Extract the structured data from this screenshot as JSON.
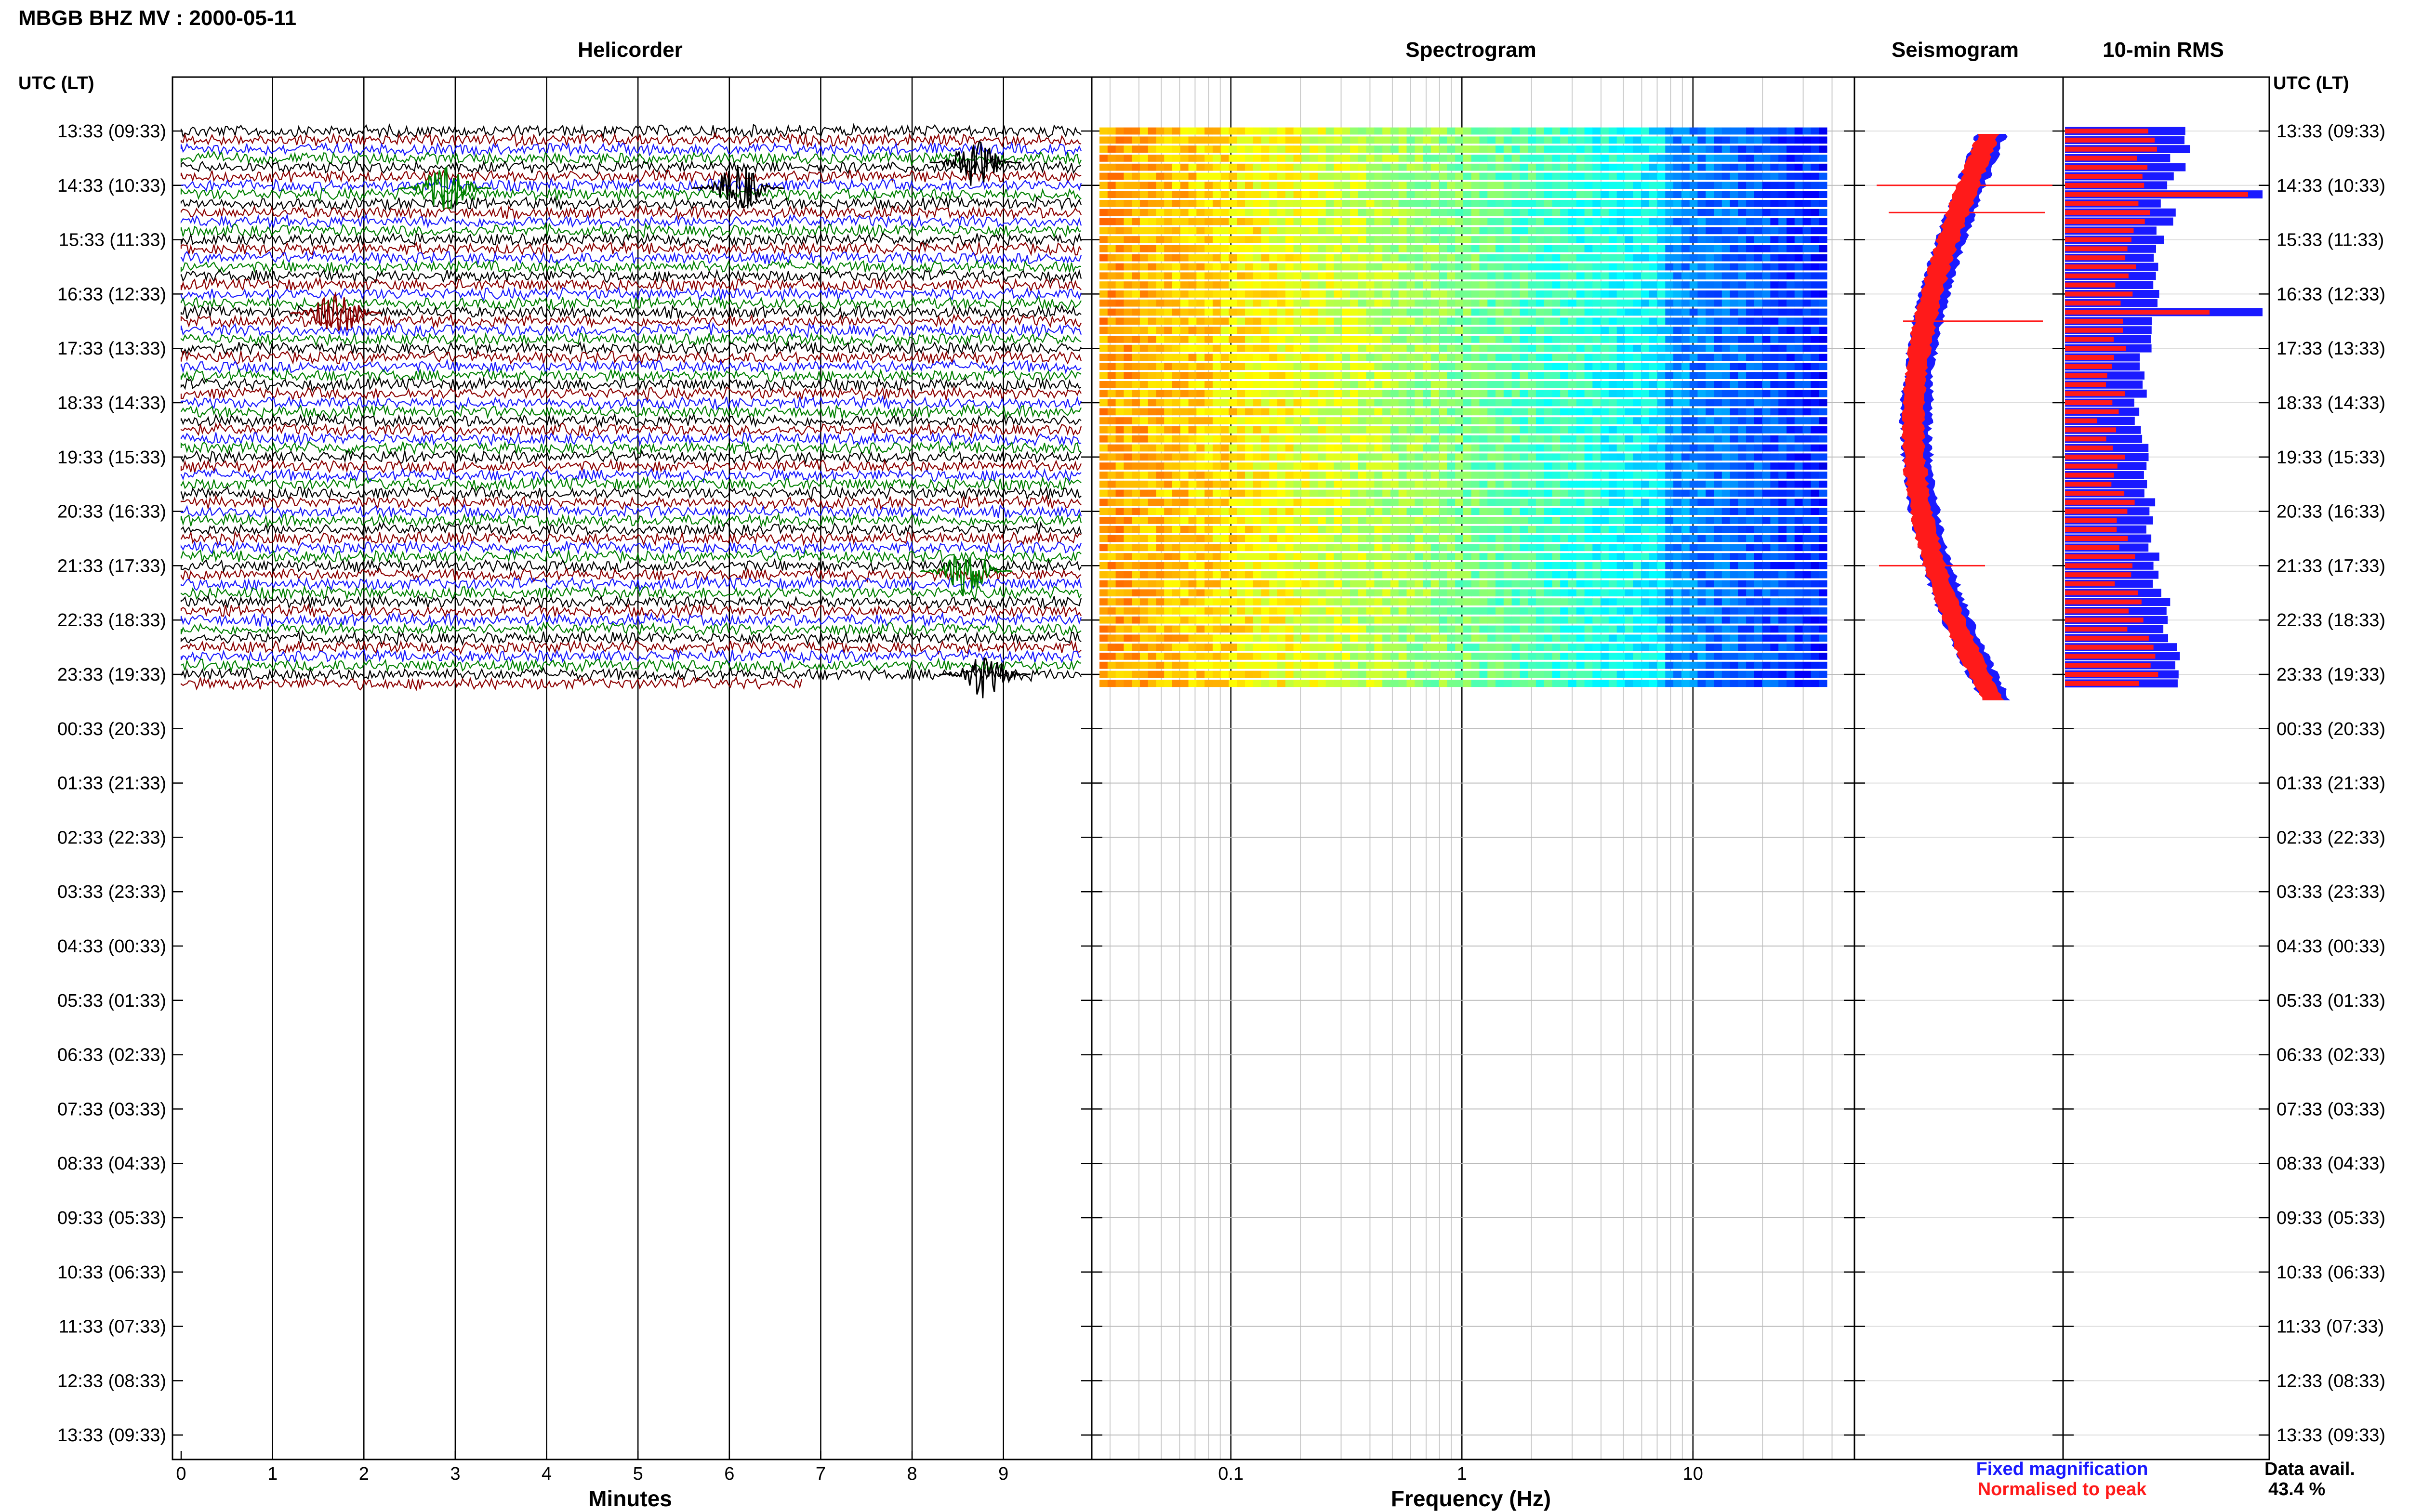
{
  "figure": {
    "title": "MBGB BHZ MV : 2000-05-11",
    "utc_header_left": "UTC (LT)",
    "utc_header_right": "UTC (LT)"
  },
  "panels": {
    "helicorder": {
      "title": "Helicorder",
      "xlabel": "Minutes",
      "xticks": [
        "0",
        "1",
        "2",
        "3",
        "4",
        "5",
        "6",
        "7",
        "8",
        "9"
      ]
    },
    "spectrogram": {
      "title": "Spectrogram",
      "xlabel": "Frequency (Hz)",
      "xticks": [
        "0.1",
        "1",
        "10"
      ]
    },
    "seismogram": {
      "title": "Seismogram"
    },
    "rms": {
      "title": "10-min RMS"
    }
  },
  "legend": {
    "fixed": "Fixed magnification",
    "normalised": "Normalised to peak",
    "fixed_color": "#1a1aff",
    "normalised_color": "#ff1a1a"
  },
  "availability": {
    "label": "Data avail.",
    "value": "43.4 %"
  },
  "chart_data": {
    "type": "line",
    "time_labels": [
      "13:33 (09:33)",
      "14:33 (10:33)",
      "15:33 (11:33)",
      "16:33 (12:33)",
      "17:33 (13:33)",
      "18:33 (14:33)",
      "19:33 (15:33)",
      "20:33 (16:33)",
      "21:33 (17:33)",
      "22:33 (18:33)",
      "23:33 (19:33)",
      "00:33 (20:33)",
      "01:33 (21:33)",
      "02:33 (22:33)",
      "03:33 (23:33)",
      "04:33 (00:33)",
      "05:33 (01:33)",
      "06:33 (02:33)",
      "07:33 (03:33)",
      "08:33 (04:33)",
      "09:33 (05:33)",
      "10:33 (06:33)",
      "11:33 (07:33)",
      "12:33 (08:33)",
      "13:33 (09:33)"
    ],
    "helicorder": {
      "xlim": [
        0,
        10
      ],
      "trace_colors": [
        "#000000",
        "#8b0000",
        "#1a1aff",
        "#008000"
      ],
      "minutes_per_line": 10,
      "data_hours": 10.4,
      "events": [
        {
          "hour_offset": 1.05,
          "minute": 2.9,
          "color": "#008000"
        },
        {
          "hour_offset": 1.05,
          "minute": 6.1,
          "color": "#000000"
        },
        {
          "hour_offset": 3.35,
          "minute": 1.7,
          "color": "#8b0000"
        },
        {
          "hour_offset": 0.58,
          "minute": 8.7,
          "color": "#000000"
        },
        {
          "hour_offset": 8.1,
          "minute": 8.6,
          "color": "#008000"
        },
        {
          "hour_offset": 10.0,
          "minute": 8.8,
          "color": "#000000"
        }
      ]
    },
    "spectrogram": {
      "xscale": "log",
      "xlim": [
        0.025,
        50
      ],
      "colormap": "jet"
    },
    "seismogram": {
      "note_series": [
        "Fixed magnification",
        "Normalised to peak"
      ]
    },
    "rms": {
      "series": [
        {
          "name": "Fixed magnification",
          "color": "#1a1aff"
        },
        {
          "name": "Normalised to peak",
          "color": "#ff1a1a"
        }
      ]
    }
  }
}
